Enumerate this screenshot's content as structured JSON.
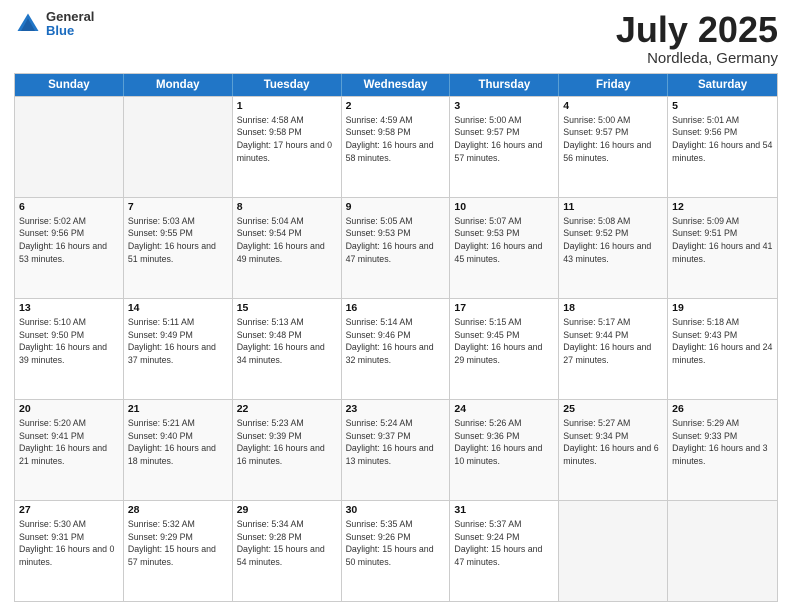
{
  "logo": {
    "general": "General",
    "blue": "Blue"
  },
  "title": {
    "month": "July 2025",
    "location": "Nordleda, Germany"
  },
  "header_days": [
    "Sunday",
    "Monday",
    "Tuesday",
    "Wednesday",
    "Thursday",
    "Friday",
    "Saturday"
  ],
  "weeks": [
    [
      {
        "day": "",
        "sunrise": "",
        "sunset": "",
        "daylight": ""
      },
      {
        "day": "",
        "sunrise": "",
        "sunset": "",
        "daylight": ""
      },
      {
        "day": "1",
        "sunrise": "Sunrise: 4:58 AM",
        "sunset": "Sunset: 9:58 PM",
        "daylight": "Daylight: 17 hours and 0 minutes."
      },
      {
        "day": "2",
        "sunrise": "Sunrise: 4:59 AM",
        "sunset": "Sunset: 9:58 PM",
        "daylight": "Daylight: 16 hours and 58 minutes."
      },
      {
        "day": "3",
        "sunrise": "Sunrise: 5:00 AM",
        "sunset": "Sunset: 9:57 PM",
        "daylight": "Daylight: 16 hours and 57 minutes."
      },
      {
        "day": "4",
        "sunrise": "Sunrise: 5:00 AM",
        "sunset": "Sunset: 9:57 PM",
        "daylight": "Daylight: 16 hours and 56 minutes."
      },
      {
        "day": "5",
        "sunrise": "Sunrise: 5:01 AM",
        "sunset": "Sunset: 9:56 PM",
        "daylight": "Daylight: 16 hours and 54 minutes."
      }
    ],
    [
      {
        "day": "6",
        "sunrise": "Sunrise: 5:02 AM",
        "sunset": "Sunset: 9:56 PM",
        "daylight": "Daylight: 16 hours and 53 minutes."
      },
      {
        "day": "7",
        "sunrise": "Sunrise: 5:03 AM",
        "sunset": "Sunset: 9:55 PM",
        "daylight": "Daylight: 16 hours and 51 minutes."
      },
      {
        "day": "8",
        "sunrise": "Sunrise: 5:04 AM",
        "sunset": "Sunset: 9:54 PM",
        "daylight": "Daylight: 16 hours and 49 minutes."
      },
      {
        "day": "9",
        "sunrise": "Sunrise: 5:05 AM",
        "sunset": "Sunset: 9:53 PM",
        "daylight": "Daylight: 16 hours and 47 minutes."
      },
      {
        "day": "10",
        "sunrise": "Sunrise: 5:07 AM",
        "sunset": "Sunset: 9:53 PM",
        "daylight": "Daylight: 16 hours and 45 minutes."
      },
      {
        "day": "11",
        "sunrise": "Sunrise: 5:08 AM",
        "sunset": "Sunset: 9:52 PM",
        "daylight": "Daylight: 16 hours and 43 minutes."
      },
      {
        "day": "12",
        "sunrise": "Sunrise: 5:09 AM",
        "sunset": "Sunset: 9:51 PM",
        "daylight": "Daylight: 16 hours and 41 minutes."
      }
    ],
    [
      {
        "day": "13",
        "sunrise": "Sunrise: 5:10 AM",
        "sunset": "Sunset: 9:50 PM",
        "daylight": "Daylight: 16 hours and 39 minutes."
      },
      {
        "day": "14",
        "sunrise": "Sunrise: 5:11 AM",
        "sunset": "Sunset: 9:49 PM",
        "daylight": "Daylight: 16 hours and 37 minutes."
      },
      {
        "day": "15",
        "sunrise": "Sunrise: 5:13 AM",
        "sunset": "Sunset: 9:48 PM",
        "daylight": "Daylight: 16 hours and 34 minutes."
      },
      {
        "day": "16",
        "sunrise": "Sunrise: 5:14 AM",
        "sunset": "Sunset: 9:46 PM",
        "daylight": "Daylight: 16 hours and 32 minutes."
      },
      {
        "day": "17",
        "sunrise": "Sunrise: 5:15 AM",
        "sunset": "Sunset: 9:45 PM",
        "daylight": "Daylight: 16 hours and 29 minutes."
      },
      {
        "day": "18",
        "sunrise": "Sunrise: 5:17 AM",
        "sunset": "Sunset: 9:44 PM",
        "daylight": "Daylight: 16 hours and 27 minutes."
      },
      {
        "day": "19",
        "sunrise": "Sunrise: 5:18 AM",
        "sunset": "Sunset: 9:43 PM",
        "daylight": "Daylight: 16 hours and 24 minutes."
      }
    ],
    [
      {
        "day": "20",
        "sunrise": "Sunrise: 5:20 AM",
        "sunset": "Sunset: 9:41 PM",
        "daylight": "Daylight: 16 hours and 21 minutes."
      },
      {
        "day": "21",
        "sunrise": "Sunrise: 5:21 AM",
        "sunset": "Sunset: 9:40 PM",
        "daylight": "Daylight: 16 hours and 18 minutes."
      },
      {
        "day": "22",
        "sunrise": "Sunrise: 5:23 AM",
        "sunset": "Sunset: 9:39 PM",
        "daylight": "Daylight: 16 hours and 16 minutes."
      },
      {
        "day": "23",
        "sunrise": "Sunrise: 5:24 AM",
        "sunset": "Sunset: 9:37 PM",
        "daylight": "Daylight: 16 hours and 13 minutes."
      },
      {
        "day": "24",
        "sunrise": "Sunrise: 5:26 AM",
        "sunset": "Sunset: 9:36 PM",
        "daylight": "Daylight: 16 hours and 10 minutes."
      },
      {
        "day": "25",
        "sunrise": "Sunrise: 5:27 AM",
        "sunset": "Sunset: 9:34 PM",
        "daylight": "Daylight: 16 hours and 6 minutes."
      },
      {
        "day": "26",
        "sunrise": "Sunrise: 5:29 AM",
        "sunset": "Sunset: 9:33 PM",
        "daylight": "Daylight: 16 hours and 3 minutes."
      }
    ],
    [
      {
        "day": "27",
        "sunrise": "Sunrise: 5:30 AM",
        "sunset": "Sunset: 9:31 PM",
        "daylight": "Daylight: 16 hours and 0 minutes."
      },
      {
        "day": "28",
        "sunrise": "Sunrise: 5:32 AM",
        "sunset": "Sunset: 9:29 PM",
        "daylight": "Daylight: 15 hours and 57 minutes."
      },
      {
        "day": "29",
        "sunrise": "Sunrise: 5:34 AM",
        "sunset": "Sunset: 9:28 PM",
        "daylight": "Daylight: 15 hours and 54 minutes."
      },
      {
        "day": "30",
        "sunrise": "Sunrise: 5:35 AM",
        "sunset": "Sunset: 9:26 PM",
        "daylight": "Daylight: 15 hours and 50 minutes."
      },
      {
        "day": "31",
        "sunrise": "Sunrise: 5:37 AM",
        "sunset": "Sunset: 9:24 PM",
        "daylight": "Daylight: 15 hours and 47 minutes."
      },
      {
        "day": "",
        "sunrise": "",
        "sunset": "",
        "daylight": ""
      },
      {
        "day": "",
        "sunrise": "",
        "sunset": "",
        "daylight": ""
      }
    ]
  ]
}
